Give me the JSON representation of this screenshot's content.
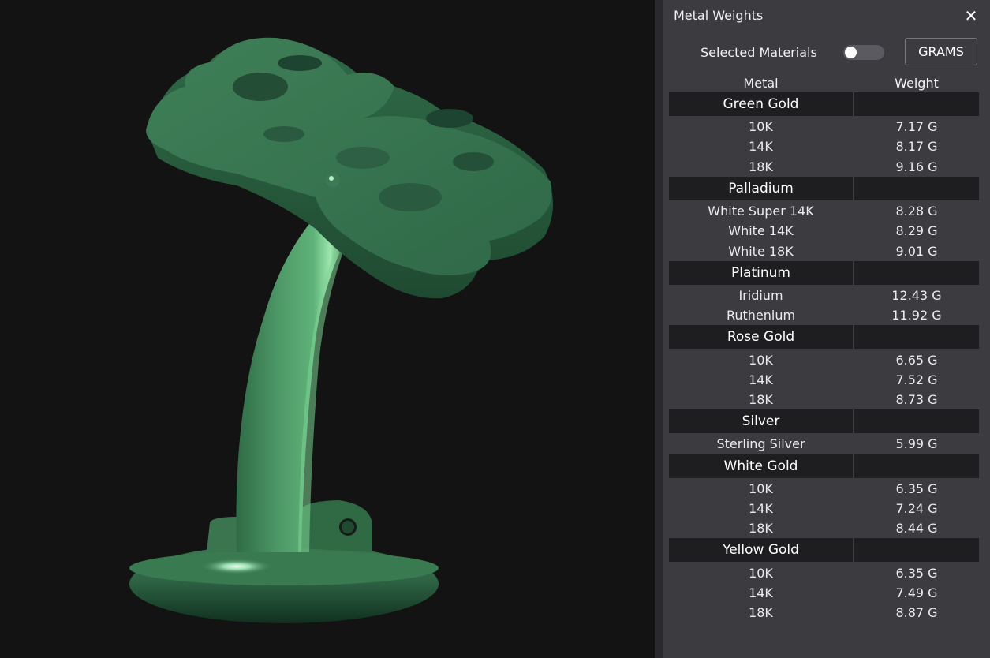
{
  "panel": {
    "title": "Metal Weights",
    "close_icon": "close-icon",
    "selected_materials_label": "Selected Materials",
    "selected_materials_on": false,
    "units_button": "GRAMS",
    "col_metal": "Metal",
    "col_weight": "Weight"
  },
  "groups": [
    {
      "name": "Green Gold",
      "items": [
        {
          "name": "10K",
          "weight": "7.17 G"
        },
        {
          "name": "14K",
          "weight": "8.17 G"
        },
        {
          "name": "18K",
          "weight": "9.16 G"
        }
      ]
    },
    {
      "name": "Palladium",
      "items": [
        {
          "name": "White Super 14K",
          "weight": "8.28 G"
        },
        {
          "name": "White 14K",
          "weight": "8.29 G"
        },
        {
          "name": "White 18K",
          "weight": "9.01 G"
        }
      ]
    },
    {
      "name": "Platinum",
      "items": [
        {
          "name": "Iridium",
          "weight": "12.43 G"
        },
        {
          "name": "Ruthenium",
          "weight": "11.92 G"
        }
      ]
    },
    {
      "name": "Rose Gold",
      "items": [
        {
          "name": "10K",
          "weight": "6.65 G"
        },
        {
          "name": "14K",
          "weight": "7.52 G"
        },
        {
          "name": "18K",
          "weight": "8.73 G"
        }
      ]
    },
    {
      "name": "Silver",
      "items": [
        {
          "name": "Sterling Silver",
          "weight": "5.99 G"
        }
      ]
    },
    {
      "name": "White Gold",
      "items": [
        {
          "name": "10K",
          "weight": "6.35 G"
        },
        {
          "name": "14K",
          "weight": "7.24 G"
        },
        {
          "name": "18K",
          "weight": "8.44 G"
        }
      ]
    },
    {
      "name": "Yellow Gold",
      "items": [
        {
          "name": "10K",
          "weight": "6.35 G"
        },
        {
          "name": "14K",
          "weight": "7.49 G"
        },
        {
          "name": "18K",
          "weight": "8.87 G"
        }
      ]
    }
  ],
  "colors": {
    "model_green": "#3f7f55",
    "panel_bg": "#3b3b40",
    "group_row_bg": "#1e1e21",
    "viewport_bg": "#131313"
  }
}
